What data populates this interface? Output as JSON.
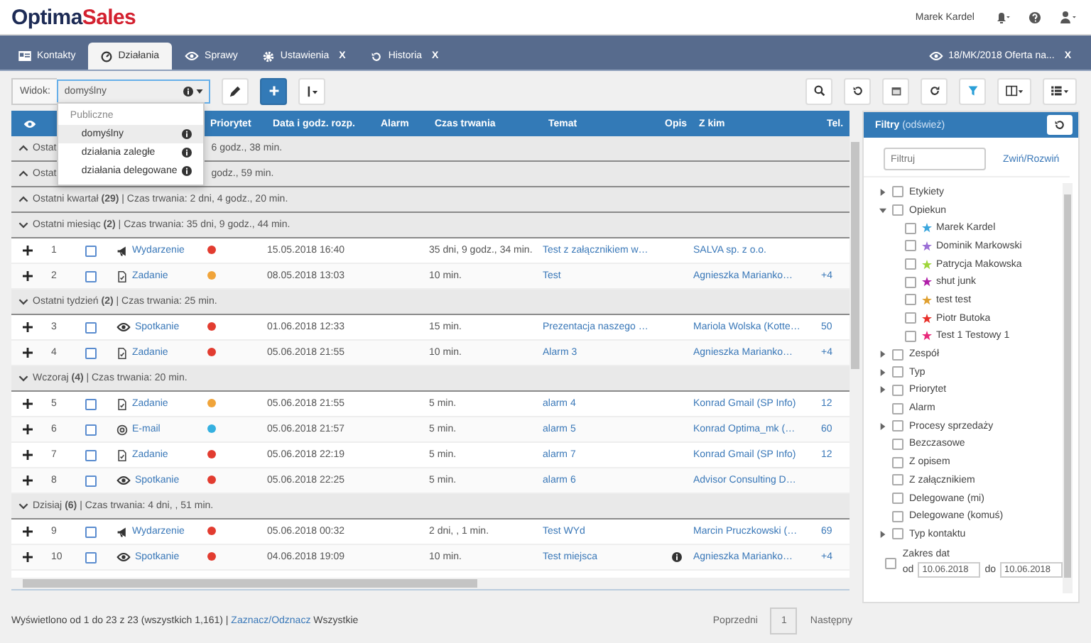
{
  "header": {
    "logo": [
      "Optima",
      "Sales"
    ],
    "user": "Marek Kardel"
  },
  "tabs": [
    {
      "kind": "contacts",
      "label": "Kontakty",
      "selected": false
    },
    {
      "kind": "activities",
      "label": "Działania",
      "selected": true
    },
    {
      "kind": "cases",
      "label": "Sprawy",
      "selected": false
    },
    {
      "kind": "settings",
      "label": "Ustawienia",
      "close": "X",
      "selected": false
    },
    {
      "kind": "history",
      "label": "Historia",
      "close": "X",
      "selected": false
    }
  ],
  "open_record_tab": {
    "label": "18/MK/2018 Oferta na...",
    "close": "X"
  },
  "toolbar": {
    "view_label": "Widok:",
    "view_value": "domyślny"
  },
  "view_menu": {
    "group": "Publiczne",
    "items": [
      {
        "label": "domyślny",
        "selected": true
      },
      {
        "label": "działania zaległe",
        "selected": false
      },
      {
        "label": "działania delegowane",
        "selected": false
      }
    ]
  },
  "table": {
    "columns": [
      "Priorytet",
      "Data i godz. rozp.",
      "Alarm",
      "Czas trwania",
      "Temat",
      "Opis",
      "Z kim",
      "Tel."
    ],
    "groups": [
      {
        "kind": "covered",
        "label_start": "Ostat",
        "label_end": "6 godz., 38 min.",
        "expanded": false
      },
      {
        "kind": "covered",
        "label_start": "Ostat",
        "label_end": "godz., 59 min.",
        "expanded": false
      },
      {
        "kind": "full",
        "label": "Ostatni kwartał **(29)** | Czas trwania: 2 dni, 4 godz., 20 min.",
        "expanded": false
      },
      {
        "kind": "full",
        "label": "Ostatni miesiąc **(2)** | Czas trwania: 35 dni, 9 godz., 44 min.",
        "expanded": true,
        "rows": [
          {
            "num": "1",
            "checked": false,
            "kind": "event",
            "type": "Wydarzenie",
            "color": "#e23c30",
            "date": "15.05.2018 16:40",
            "duration": "35 dni, 9 godz., 34 min.",
            "subject": "Test z załącznikiem w…",
            "has_description": false,
            "contact": "SALVA sp. z o.o."
          },
          {
            "num": "2",
            "checked": false,
            "kind": "task",
            "type": "Zadanie",
            "color": "#f0a43a",
            "date": "08.05.2018 13:03",
            "duration": "10 min.",
            "subject": "Test",
            "has_description": false,
            "contact": "Agnieszka Marianko…",
            "phone": "+4"
          }
        ]
      },
      {
        "kind": "full",
        "label": "Ostatni tydzień **(2)** | Czas trwania: 25 min.",
        "expanded": true,
        "rows": [
          {
            "num": "3",
            "checked": false,
            "kind": "meeting",
            "type": "Spotkanie",
            "color": "#e23c30",
            "date": "01.06.2018 12:33",
            "duration": "15 min.",
            "subject": "Prezentacja naszego …",
            "has_description": false,
            "contact": "Mariola Wolska (Kotte…",
            "phone": "50"
          },
          {
            "num": "4",
            "checked": false,
            "kind": "task",
            "type": "Zadanie",
            "color": "#e23c30",
            "date": "05.06.2018 21:55",
            "duration": "10 min.",
            "subject": "Alarm 3",
            "has_description": false,
            "contact": "Agnieszka Marianko…",
            "phone": "+4"
          }
        ]
      },
      {
        "kind": "full",
        "label": "Wczoraj **(4)** | Czas trwania: 20 min.",
        "expanded": true,
        "rows": [
          {
            "num": "5",
            "checked": false,
            "kind": "task",
            "type": "Zadanie",
            "color": "#f0a43a",
            "date": "05.06.2018 21:55",
            "duration": "5 min.",
            "subject": "alarm 4",
            "has_description": false,
            "contact": "Konrad Gmail (SP Info)",
            "phone": "12"
          },
          {
            "num": "6",
            "checked": false,
            "kind": "email",
            "type": "E-mail",
            "color": "#35b0e0",
            "date": "05.06.2018 21:57",
            "duration": "5 min.",
            "subject": "alarm 5",
            "has_description": false,
            "contact": "Konrad Optima_mk (…",
            "phone": "60"
          },
          {
            "num": "7",
            "checked": false,
            "kind": "task",
            "type": "Zadanie",
            "color": "#e23c30",
            "date": "05.06.2018 22:19",
            "duration": "5 min.",
            "subject": "alarm 7",
            "has_description": false,
            "contact": "Konrad Gmail (SP Info)",
            "phone": "12"
          },
          {
            "num": "8",
            "checked": false,
            "kind": "meeting",
            "type": "Spotkanie",
            "color": "#e23c30",
            "date": "05.06.2018 22:25",
            "duration": "5 min.",
            "subject": "alarm 6",
            "has_description": false,
            "contact": "Advisor Consulting D…"
          }
        ]
      },
      {
        "kind": "full",
        "label": "Dzisiaj **(6)** | Czas trwania: 4 dni, , 51 min.",
        "expanded": true,
        "rows": [
          {
            "num": "9",
            "checked": false,
            "kind": "event",
            "type": "Wydarzenie",
            "color": "#e23c30",
            "date": "05.06.2018 00:32",
            "duration": "2 dni, , 1 min.",
            "subject": "Test WYd",
            "has_description": false,
            "contact": "Marcin Pruczkowski (…",
            "phone": "69"
          },
          {
            "num": "10",
            "checked": false,
            "kind": "meeting",
            "type": "Spotkanie",
            "color": "#e23c30",
            "date": "04.06.2018 19:09",
            "duration": "10 min.",
            "subject": "Test miejsca",
            "has_description": true,
            "contact": "Agnieszka Marianko…",
            "phone": "+4"
          }
        ]
      }
    ]
  },
  "footer": {
    "summary": "Wyświetlono od 1 do 23 z 23 (wszystkich 1,161) |",
    "link": "Zaznacz/Odznacz",
    "after": "Wszystkie"
  },
  "pagination": {
    "prev": "Poprzedni",
    "pages": [
      {
        "label": "1",
        "selected": true
      }
    ],
    "next": "Następny"
  },
  "filters": {
    "title": "Filtry",
    "refresh": "(odśwież)",
    "search_placeholder": "Filtruj",
    "toggle": "Zwiń/Rozwiń",
    "items": [
      {
        "kind": "branch",
        "label": "Etykiety",
        "checked": false,
        "expanded": false
      },
      {
        "kind": "branch",
        "label": "Opiekun",
        "checked": false,
        "expanded": true,
        "children": [
          {
            "kind": "person",
            "label": "Marek Kardel",
            "checked": false,
            "color": "#3aa6dd"
          },
          {
            "kind": "person",
            "label": "Dominik Markowski",
            "checked": false,
            "color": "#9b6fd6"
          },
          {
            "kind": "person",
            "label": "Patrycja Makowska",
            "checked": false,
            "color": "#9fd63a"
          },
          {
            "kind": "person",
            "label": "shut junk",
            "checked": false,
            "color": "#b01fa8"
          },
          {
            "kind": "person",
            "label": "test test",
            "checked": false,
            "color": "#e0a030"
          },
          {
            "kind": "person",
            "label": "Piotr Butoka",
            "checked": false,
            "color": "#e8302a"
          },
          {
            "kind": "person",
            "label": "Test 1 Testowy 1",
            "checked": false,
            "color": "#e8287a"
          }
        ]
      },
      {
        "kind": "branch",
        "label": "Zespół",
        "checked": false,
        "expanded": false
      },
      {
        "kind": "branch",
        "label": "Typ",
        "checked": false,
        "expanded": false
      },
      {
        "kind": "branch",
        "label": "Priorytet",
        "checked": false,
        "expanded": false
      },
      {
        "kind": "leaf",
        "label": "Alarm",
        "checked": false
      },
      {
        "kind": "branch",
        "label": "Procesy sprzedaży",
        "checked": false,
        "expanded": false
      },
      {
        "kind": "leaf",
        "label": "Bezczasowe",
        "checked": false
      },
      {
        "kind": "leaf",
        "label": "Z opisem",
        "checked": false
      },
      {
        "kind": "leaf",
        "label": "Z załącznikiem",
        "checked": false
      },
      {
        "kind": "leaf",
        "label": "Delegowane (mi)",
        "checked": false
      },
      {
        "kind": "leaf",
        "label": "Delegowane (komuś)",
        "checked": false
      },
      {
        "kind": "branch",
        "label": "Typ kontaktu",
        "checked": false,
        "expanded": false
      },
      {
        "kind": "date_range",
        "label": "Zakres dat",
        "checked": false,
        "from_label": "od",
        "from": "10.06.2018",
        "to_label": "do",
        "to": "10.06.2018"
      }
    ]
  }
}
